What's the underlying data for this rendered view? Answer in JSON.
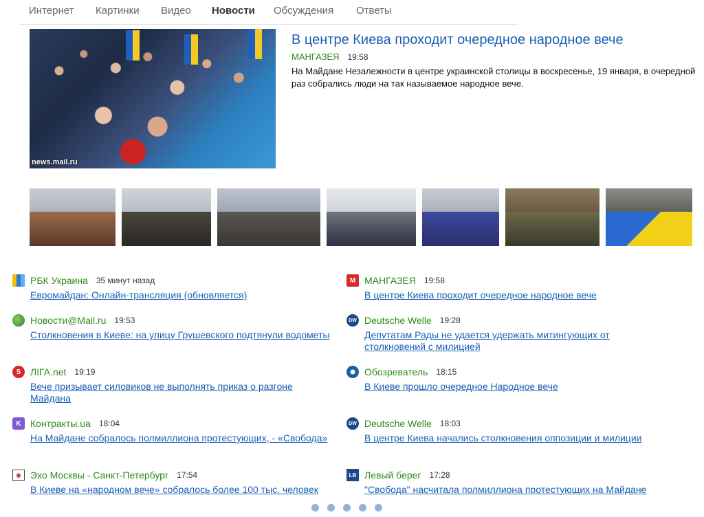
{
  "tabs": [
    "Интернет",
    "Картинки",
    "Видео",
    "Новости",
    "Обсуждения",
    "Ответы"
  ],
  "active_tab": "Новости",
  "lead": {
    "title": "В центре Киева проходит очередное народное вече",
    "source": "МАНГАЗЕЯ",
    "time": "19:58",
    "text": "На Майдане Незалежности в центре украинской столицы в воскресенье, 19 января, в очередной раз собрались люди на так называемое народное вече.",
    "photo_credit": "news.mail.ru"
  },
  "left_column": [
    {
      "source": "РБК Украина",
      "time": "35 минут назад",
      "title": "Евромайдан: Онлайн-трансляция (обновляется)",
      "icon": "rbc-icon"
    },
    {
      "source": "Новости@Mail.ru",
      "time": "19:53",
      "title": "Столкновения в Киеве: на улицу Грушевского подтянули водометы",
      "icon": "mailru-icon"
    },
    {
      "source": "ЛIГА.net",
      "time": "19:19",
      "title": "Вече призывает силовиков не выполнять приказ о разгоне Майдана",
      "icon": "liga-icon"
    },
    {
      "source": "Контракты.ua",
      "time": "18:04",
      "title": "На Майдане собралось полмиллиона протестующих, - «Свобода»",
      "icon": "kontrakty-icon"
    },
    {
      "source": "Эхо Москвы - Санкт-Петербург",
      "time": "17:54",
      "title": "В Киеве на «народном вече» собралось более 100 тыс. человек",
      "icon": "echo-icon"
    }
  ],
  "right_column": [
    {
      "source": "МАНГАЗЕЯ",
      "time": "19:58",
      "title": "В центре Киева проходит очередное народное вече",
      "icon": "mangazeya-icon"
    },
    {
      "source": "Deutsche Welle",
      "time": "19:28",
      "title": "Депутатам Рады не удается удержать митингующих от столкновений с милицией",
      "icon": "dw-icon"
    },
    {
      "source": "Обозреватель",
      "time": "18:15",
      "title": "В Киеве прошло очередное Народное вече",
      "icon": "obozrevatel-icon"
    },
    {
      "source": "Deutsche Welle",
      "time": "18:03",
      "title": "В центре Киева начались столкновения оппозиции и милиции",
      "icon": "dw-icon"
    },
    {
      "source": "Левый берег",
      "time": "17:28",
      "title": "\"Свобода\" насчитала полмиллиона протестующих на Майдане",
      "icon": "lb-icon"
    }
  ],
  "icon_labels": {
    "mangazeya": "M",
    "liga": "S",
    "kontrakty": "K",
    "lb": "LB",
    "dw": "DW"
  },
  "thumbnail_count": 7,
  "page_dots": 5,
  "colors": {
    "link": "#1a5fb4",
    "source": "#2e8b1a",
    "dot": "#8fb4d6"
  }
}
